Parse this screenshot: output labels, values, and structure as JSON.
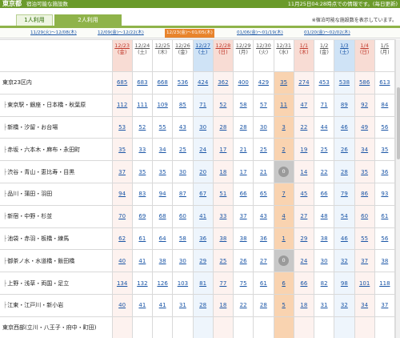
{
  "header": {
    "prefecture": "東京都",
    "subtitle": "宿泊可能な施設数",
    "update_note": "11月25日04:28時点での情報です。(毎日更新)"
  },
  "people_tabs": [
    {
      "label": "1人利用",
      "active": false
    },
    {
      "label": "2人利用",
      "active": true
    }
  ],
  "note": "※宿泊可能な施設数を表示しています。",
  "weeks": [
    {
      "label": "11/29(火)〜12/08(木)",
      "active": false
    },
    {
      "label": "12/09(金)〜12/22(木)",
      "active": false
    },
    {
      "label": "12/23(金)〜01/05(木)",
      "active": true
    },
    {
      "label": "01/06(金)〜01/19(木)",
      "active": false
    },
    {
      "label": "01/20(金)〜02/02(木)",
      "active": false
    }
  ],
  "days": [
    {
      "date": "12/23",
      "dow": "(金)",
      "type": "hol"
    },
    {
      "date": "12/24",
      "dow": "(土)",
      "type": "normal"
    },
    {
      "date": "12/25",
      "dow": "(木)",
      "type": "normal"
    },
    {
      "date": "12/26",
      "dow": "(金)",
      "type": "normal"
    },
    {
      "date": "12/27",
      "dow": "(土)",
      "type": "sat"
    },
    {
      "date": "12/28",
      "dow": "(日)",
      "type": "hol"
    },
    {
      "date": "12/29",
      "dow": "(月)",
      "type": "normal"
    },
    {
      "date": "12/30",
      "dow": "(火)",
      "type": "normal"
    },
    {
      "date": "12/31",
      "dow": "(水)",
      "type": "normal"
    },
    {
      "date": "1/1",
      "dow": "(木)",
      "type": "hol"
    },
    {
      "date": "1/2",
      "dow": "(金)",
      "type": "normal"
    },
    {
      "date": "1/3",
      "dow": "(土)",
      "type": "sat"
    },
    {
      "date": "1/4",
      "dow": "(日)",
      "type": "hol"
    },
    {
      "date": "1/5",
      "dow": "(月)",
      "type": "normal"
    }
  ],
  "rows": [
    {
      "area": "東京23区内",
      "sub": false,
      "values": [
        "685",
        "683",
        "668",
        "536",
        "424",
        "362",
        "400",
        "429",
        "35",
        "274",
        "453",
        "538",
        "586",
        "613"
      ]
    },
    {
      "area": "東京駅・銀座・日本橋・秋葉原",
      "sub": true,
      "values": [
        "112",
        "111",
        "109",
        "85",
        "71",
        "52",
        "58",
        "57",
        "11",
        "47",
        "71",
        "89",
        "92",
        "84"
      ]
    },
    {
      "area": "新橋・汐留・お台場",
      "sub": true,
      "values": [
        "53",
        "52",
        "55",
        "43",
        "30",
        "28",
        "28",
        "30",
        "3",
        "22",
        "44",
        "46",
        "49",
        "56"
      ]
    },
    {
      "area": "赤坂・六本木・麻布・永田町",
      "sub": true,
      "values": [
        "35",
        "33",
        "34",
        "25",
        "24",
        "17",
        "21",
        "25",
        "2",
        "19",
        "25",
        "26",
        "34",
        "35"
      ]
    },
    {
      "area": "渋谷・青山・恵比寿・目黒",
      "sub": true,
      "values": [
        "37",
        "35",
        "35",
        "30",
        "20",
        "18",
        "17",
        "21",
        "0",
        "14",
        "22",
        "28",
        "35",
        "36"
      ]
    },
    {
      "area": "品川・蒲田・羽田",
      "sub": true,
      "values": [
        "94",
        "83",
        "94",
        "87",
        "67",
        "51",
        "66",
        "65",
        "7",
        "45",
        "66",
        "79",
        "86",
        "93"
      ]
    },
    {
      "area": "新宿・中野・杉並",
      "sub": true,
      "values": [
        "70",
        "69",
        "68",
        "60",
        "41",
        "33",
        "37",
        "43",
        "4",
        "27",
        "48",
        "54",
        "60",
        "61"
      ]
    },
    {
      "area": "池袋・赤羽・板橋・練馬",
      "sub": true,
      "values": [
        "62",
        "61",
        "64",
        "58",
        "36",
        "38",
        "38",
        "36",
        "1",
        "29",
        "38",
        "46",
        "55",
        "56"
      ]
    },
    {
      "area": "御茶ノ水・水道橋・飯田橋",
      "sub": true,
      "values": [
        "40",
        "41",
        "38",
        "30",
        "29",
        "25",
        "26",
        "27",
        "0",
        "24",
        "30",
        "32",
        "37",
        "38"
      ]
    },
    {
      "area": "上野・浅草・両国・足立",
      "sub": true,
      "values": [
        "134",
        "132",
        "126",
        "103",
        "81",
        "77",
        "75",
        "61",
        "6",
        "66",
        "82",
        "98",
        "101",
        "118"
      ]
    },
    {
      "area": "江東・江戸川・新小岩",
      "sub": true,
      "values": [
        "40",
        "41",
        "41",
        "31",
        "28",
        "18",
        "22",
        "28",
        "5",
        "18",
        "31",
        "32",
        "34",
        "37"
      ]
    },
    {
      "area": "東京西部(立川・八王子・府中・町田)",
      "sub": false,
      "values": [
        "",
        "",
        "",
        "",
        "",
        "",
        "",
        "",
        "",
        "",
        "",
        "",
        "",
        ""
      ]
    }
  ],
  "highlight_column": "12/31",
  "colors": {
    "header_green": "#6a9a2a",
    "active_week_orange": "#e8842c",
    "link_blue": "#1a55a6",
    "highlight": "#f9d3b0"
  }
}
